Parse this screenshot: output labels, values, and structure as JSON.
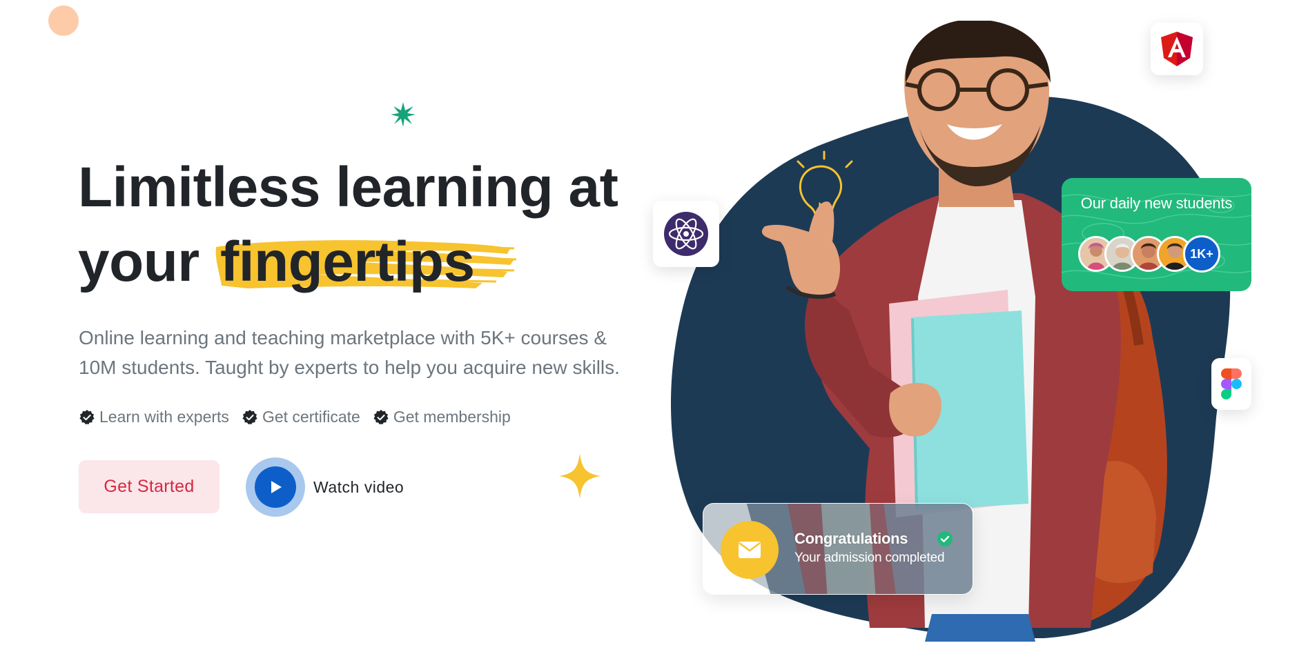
{
  "hero": {
    "title_line1": "Limitless learning at",
    "title_line2_prefix": "your",
    "title_highlight": "fingertips",
    "description": "Online learning and teaching marketplace with 5K+ courses & 10M students. Taught by experts to help you acquire new skills."
  },
  "features": [
    {
      "label": "Learn with experts"
    },
    {
      "label": "Get certificate"
    },
    {
      "label": "Get membership"
    }
  ],
  "actions": {
    "get_started": "Get Started",
    "watch_video": "Watch video"
  },
  "students_card": {
    "title": "Our daily new students",
    "count": "1K+"
  },
  "congrats_card": {
    "title": "Congratulations",
    "subtitle": "Your admission completed"
  },
  "colors": {
    "heading": "#212529",
    "muted": "#6c757d",
    "brand_red": "#d6293e",
    "brand_blue": "#0d5ec9",
    "highlight_yellow": "#f7c32e",
    "green": "#22b97c",
    "blob_navy": "#1d3a55"
  },
  "icons": {
    "atom_card": "atom-icon",
    "angular_card": "angular-icon",
    "figma_card": "figma-icon",
    "play": "play-icon",
    "mail": "mail-icon",
    "feature_check": "check-badge-icon"
  }
}
